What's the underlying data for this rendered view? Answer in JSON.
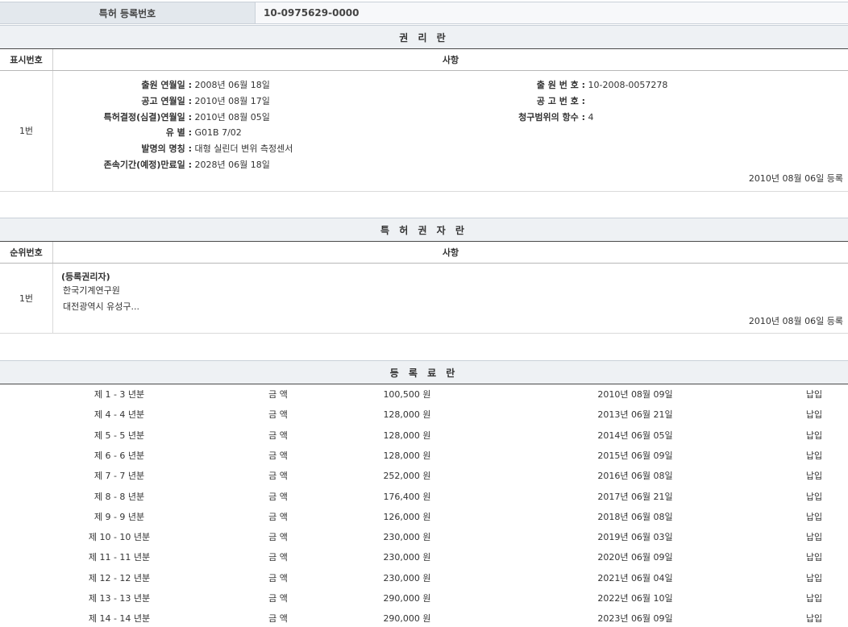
{
  "registration": {
    "label": "특허 등록번호",
    "number": "10-0975629-0000"
  },
  "rights_section": {
    "title": "권 리 란",
    "col_index": "표시번호",
    "col_detail": "사항",
    "entry": {
      "index": "1번",
      "left": [
        {
          "key": "출원 연월일 :",
          "value": "2008년 06월 18일"
        },
        {
          "key": "공고 연월일 :",
          "value": "2010년 08월 17일"
        },
        {
          "key": "특허결정(심결)연월일 :",
          "value": "2010년 08월 05일"
        },
        {
          "key": "유 별 :",
          "value": "G01B 7/02"
        },
        {
          "key": "발명의 명칭 :",
          "value": "대형 실린더 변위 측정센서"
        },
        {
          "key": "존속기간(예정)만료일 :",
          "value": "2028년 06월 18일"
        }
      ],
      "right": [
        {
          "key": "출 원 번 호 :",
          "value": "10-2008-0057278"
        },
        {
          "key": "공 고 번 호 :",
          "value": ""
        },
        {
          "key": "청구범위의 항수 :",
          "value": "4"
        }
      ],
      "registered": "2010년 08월 06일 등록"
    }
  },
  "holder_section": {
    "title": "특 허 권 자 란",
    "col_index": "순위번호",
    "col_detail": "사항",
    "entry": {
      "index": "1번",
      "role": "(등록권리자)",
      "name": "한국기계연구원",
      "address": "대전광역시 유성구...",
      "registered": "2010년 08월 06일 등록"
    }
  },
  "fee_section": {
    "title": "등 록 료 란",
    "rows": [
      {
        "period": "제 1 - 3 년분",
        "label": "금 액",
        "amount": "100,500 원",
        "date": "2010년 08월 09일",
        "status": "납입"
      },
      {
        "period": "제 4 - 4 년분",
        "label": "금 액",
        "amount": "128,000 원",
        "date": "2013년 06월 21일",
        "status": "납입"
      },
      {
        "period": "제 5 - 5 년분",
        "label": "금 액",
        "amount": "128,000 원",
        "date": "2014년 06월 05일",
        "status": "납입"
      },
      {
        "period": "제 6 - 6 년분",
        "label": "금 액",
        "amount": "128,000 원",
        "date": "2015년 06월 09일",
        "status": "납입"
      },
      {
        "period": "제 7 - 7 년분",
        "label": "금 액",
        "amount": "252,000 원",
        "date": "2016년 06월 08일",
        "status": "납입"
      },
      {
        "period": "제 8 - 8 년분",
        "label": "금 액",
        "amount": "176,400 원",
        "date": "2017년 06월 21일",
        "status": "납입"
      },
      {
        "period": "제 9 - 9 년분",
        "label": "금 액",
        "amount": "126,000 원",
        "date": "2018년 06월 08일",
        "status": "납입"
      },
      {
        "period": "제 10 - 10 년분",
        "label": "금 액",
        "amount": "230,000 원",
        "date": "2019년 06월 03일",
        "status": "납입"
      },
      {
        "period": "제 11 - 11 년분",
        "label": "금 액",
        "amount": "230,000 원",
        "date": "2020년 06월 09일",
        "status": "납입"
      },
      {
        "period": "제 12 - 12 년분",
        "label": "금 액",
        "amount": "230,000 원",
        "date": "2021년 06월 04일",
        "status": "납입"
      },
      {
        "period": "제 13 - 13 년분",
        "label": "금 액",
        "amount": "290,000 원",
        "date": "2022년 06월 10일",
        "status": "납입"
      },
      {
        "period": "제 14 - 14 년분",
        "label": "금 액",
        "amount": "290,000 원",
        "date": "2023년 06월 09일",
        "status": "납입"
      }
    ]
  }
}
